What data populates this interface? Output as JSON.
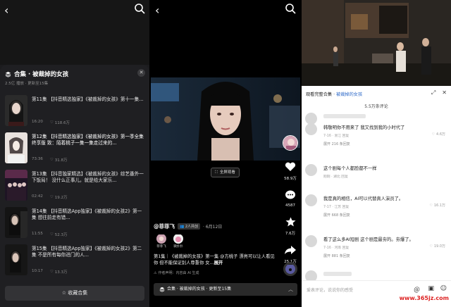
{
  "panel_left": {
    "sheet": {
      "title": "合集 · 被裁掉的女孩",
      "subtitle": "2.5亿 播放 · 更新至15集"
    },
    "episodes": [
      {
        "title": "第11集 【抖音精选独家】《被裁掉的女孩》第十一集...",
        "duration": "16:20",
        "views": "118.6万"
      },
      {
        "title": "第12集 【抖音精选独家】《被裁掉的女孩》第一季全集终享版 致：陌着桃子一集一集走过来的...",
        "duration": "73:36",
        "views": "31.8万"
      },
      {
        "title": "第13集 【抖音独家精选】《被裁掉的女孩》综艺番外一下饭局！ 没什么正事儿，就是给大家乐...",
        "duration": "02:42",
        "views": "19.2万"
      },
      {
        "title": "第14集 【抖音精选App独家】《被裁掉的女孩2》第一集 想往前走有错...",
        "duration": "11:55",
        "views": "52.3万"
      },
      {
        "title": "第15集 【抖音精选App独家】《被裁掉的女孩2》第二集 不是所有每你进门的人...",
        "duration": "10:17",
        "views": "13.3万"
      }
    ],
    "favorite_label": "收藏合集"
  },
  "panel_mid": {
    "fullscreen_label": "全屏观看",
    "rail": {
      "likes": "58.9万",
      "comments": "4587",
      "favorites": "7.6万",
      "shares": "25.1万"
    },
    "author": "@菲菲飞",
    "coauthor_tag": "2人共创",
    "date": "· 6月12日",
    "coauthors": [
      {
        "name": "菲菲飞"
      },
      {
        "name": "微扑扑"
      }
    ],
    "description": "第1集｜《被裁掉的女孩》第一集 @方桃子 漂亮可以让人看见你 但不能保证别人尊重你 女...",
    "expand_label": "展开",
    "ai_note": "作者声明：内容由 AI 生成",
    "collection_bar": "合集 · 被裁掉的女孩 · 更新至15集"
  },
  "panel_right": {
    "watch_prefix": "观看完整合集 · ",
    "watch_collection": "被裁掉的女孩",
    "comment_count": "5.5万条评论",
    "comments": [
      {
        "text": "",
        "meta": "",
        "likes": "",
        "replies": ""
      },
      {
        "text": "韩敬明你不用来了 我又找到我的小时代了",
        "meta": "7-16 · 浙江  回复",
        "likes": "4.6万",
        "replies": "展开 216 条回复"
      },
      {
        "text": "这个剧每个人都脸都不一样",
        "meta": "刚刚 · 湖北  回复",
        "likes": "",
        "replies": ""
      },
      {
        "text": "我是真的相信，AI可以代替真人演员了。",
        "meta": "7-17 · 江苏  回复",
        "likes": "16.1万",
        "replies": "展开 668 条回复"
      },
      {
        "text": "看了这么多AI短剧 这个剧是最夯的。夯爆了。",
        "meta": "7-16 · 河南  回复",
        "likes": "19.0万",
        "replies": "展开 881 条回复"
      }
    ],
    "input_placeholder": "爱表评论，说说你的感受",
    "watermark": "www.365jz.com"
  },
  "colors": {
    "accent_red": "#fe2c55",
    "link_blue": "#2c68c8",
    "sheet_bg": "#1f1f22",
    "watermark": "#dd2222"
  }
}
